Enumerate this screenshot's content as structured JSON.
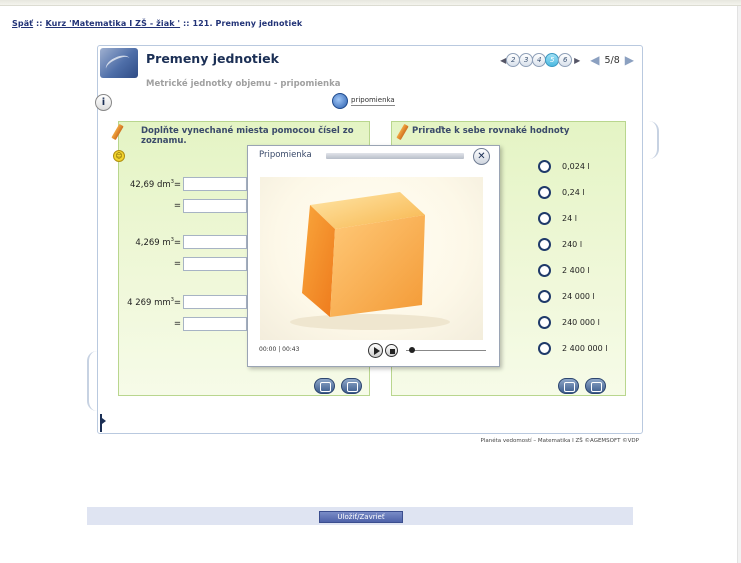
{
  "breadcrumb": {
    "back": "Späť",
    "sep1": " :: ",
    "course": "Kurz 'Matematika I ZŠ - žiak '",
    "sep2": " :: ",
    "lesson": "121. Premeny jednotiek"
  },
  "header": {
    "title": "Premeny jednotiek",
    "subtitle": "Metrické jednotky objemu - pripomienka",
    "pages": [
      "2",
      "3",
      "4",
      "5",
      "6"
    ],
    "active_page": "5",
    "page_indicator": "5/8",
    "remind_label": "pripomienka"
  },
  "left_panel": {
    "instruction": "Doplňte vynechané miesta pomocou čísel zo zoznamu.",
    "rows": [
      {
        "label": "42,69 dm³="
      },
      {
        "label": "="
      },
      {
        "label": "4,269 m³="
      },
      {
        "label": "="
      },
      {
        "label": "4 269 mm³="
      },
      {
        "label": "="
      }
    ]
  },
  "right_panel": {
    "instruction": "Priraďte k sebe rovnaké hodnoty",
    "options": [
      "0,024 l",
      "0,24 l",
      "24 l",
      "240 l",
      "2 400 l",
      "24 000 l",
      "240 000 l",
      "2 400 000 l"
    ]
  },
  "popup": {
    "title": "Pripomienka",
    "time": "00:00 | 00:43"
  },
  "footer_note": "Planéta vedomostí – Matematika I ZŠ  ©AGEMSOFT ©VDP",
  "bottom": {
    "save_label": "Uložiť/Zavrieť"
  },
  "colors": {
    "panel_green": "#e4f4c4",
    "cube_orange": "#f59a30",
    "title_navy": "#1b2f55"
  }
}
